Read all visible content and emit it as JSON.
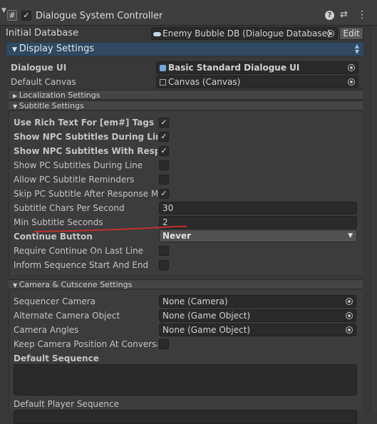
{
  "header": {
    "hash_icon": "#",
    "check_mark": "✓",
    "title": "Dialogue System Controller",
    "help_icon": "?",
    "settings_icon": "⇄",
    "menu_icon": "⋮"
  },
  "initial_database": {
    "label": "Initial Database",
    "value": "Enemy Bubble DB (Dialogue Database)",
    "edit_label": "Edit"
  },
  "display_settings": {
    "label": "Display Settings",
    "dialogue_ui_label": "Dialogue UI",
    "dialogue_ui_value": "Basic Standard Dialogue UI",
    "default_canvas_label": "Default Canvas",
    "default_canvas_value": "Canvas (Canvas)"
  },
  "localization_settings": {
    "label": "Localization Settings"
  },
  "subtitle_settings": {
    "label": "Subtitle Settings",
    "rows": [
      {
        "label": "Use Rich Text For [em#] Tags",
        "checked": true,
        "bold": true
      },
      {
        "label": "Show NPC Subtitles During Line",
        "checked": true,
        "bold": true
      },
      {
        "label": "Show NPC Subtitles With Responses",
        "checked": true,
        "bold": true
      },
      {
        "label": "Show PC Subtitles During Line",
        "checked": false,
        "bold": false
      },
      {
        "label": "Allow PC Subtitle Reminders",
        "checked": false,
        "bold": false
      },
      {
        "label": "Skip PC Subtitle After Response Menu",
        "checked": true,
        "bold": false
      }
    ],
    "chars_per_second_label": "Subtitle Chars Per Second",
    "chars_per_second_value": "30",
    "min_seconds_label": "Min Subtitle Seconds",
    "min_seconds_value": "2",
    "continue_button_label": "Continue Button",
    "continue_button_value": "Never",
    "require_continue_label": "Require Continue On Last Line",
    "inform_sequence_label": "Inform Sequence Start And End"
  },
  "camera_settings": {
    "label": "Camera & Cutscene Settings",
    "sequencer_camera_label": "Sequencer Camera",
    "sequencer_camera_value": "None (Camera)",
    "alternate_camera_label": "Alternate Camera Object",
    "alternate_camera_value": "None (Game Object)",
    "camera_angles_label": "Camera Angles",
    "camera_angles_value": "None (Game Object)",
    "keep_position_label": "Keep Camera Position At Conversation End",
    "default_sequence_label": "Default Sequence",
    "default_player_sequence_label": "Default Player Sequence"
  },
  "colors": {
    "annotation_line": "#c0302c",
    "section_blue": "#2f4960",
    "panel_bg": "#383838"
  }
}
